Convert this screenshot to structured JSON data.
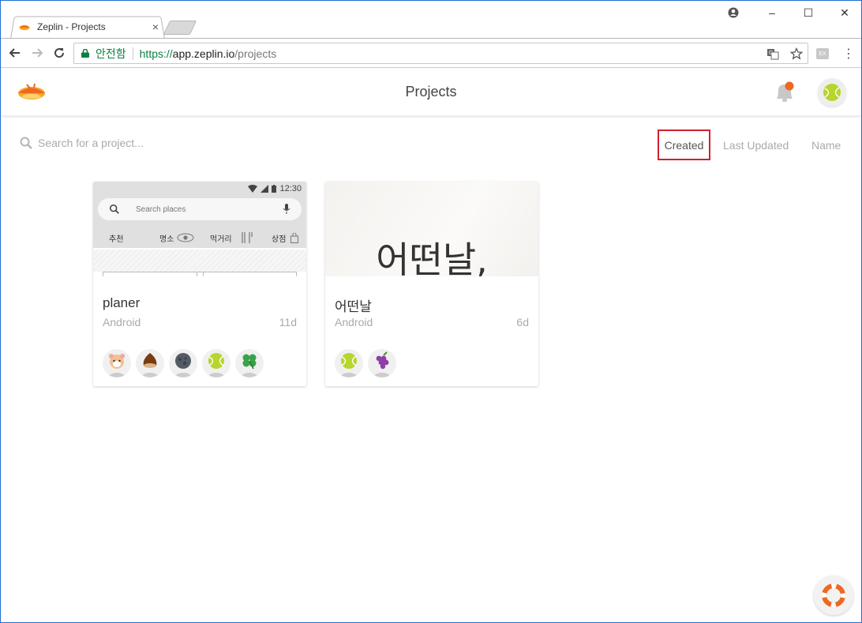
{
  "browser": {
    "tab_title": "Zeplin - Projects",
    "tab_close": "×",
    "secure_label": "안전함",
    "url_scheme": "https://",
    "url_host": "app.zeplin.io",
    "url_path": "/projects",
    "window_controls": {
      "minimize": "–",
      "maximize": "☐",
      "close": "✕"
    }
  },
  "header": {
    "title": "Projects"
  },
  "search": {
    "placeholder": "Search for a project..."
  },
  "sort": {
    "created": "Created",
    "last_updated": "Last Updated",
    "name": "Name",
    "active": "created"
  },
  "projects": [
    {
      "name": "planer",
      "platform": "Android",
      "age": "11d",
      "thumbnail": {
        "time": "12:30",
        "search_placeholder": "Search places",
        "categories": [
          "추천",
          "명소",
          "먹거리",
          "상점"
        ]
      },
      "members": [
        "hamster-icon",
        "chestnut-icon",
        "moon-icon",
        "tennis-ball-icon",
        "clover-icon"
      ]
    },
    {
      "name": "어떤날",
      "platform": "Android",
      "age": "6d",
      "thumbnail": {
        "text": "어떤날,"
      },
      "members": [
        "tennis-ball-icon",
        "grapes-icon"
      ]
    }
  ],
  "colors": {
    "accent": "#ee6723",
    "secure_green": "#0b8043",
    "highlight_border": "#d0202f"
  }
}
